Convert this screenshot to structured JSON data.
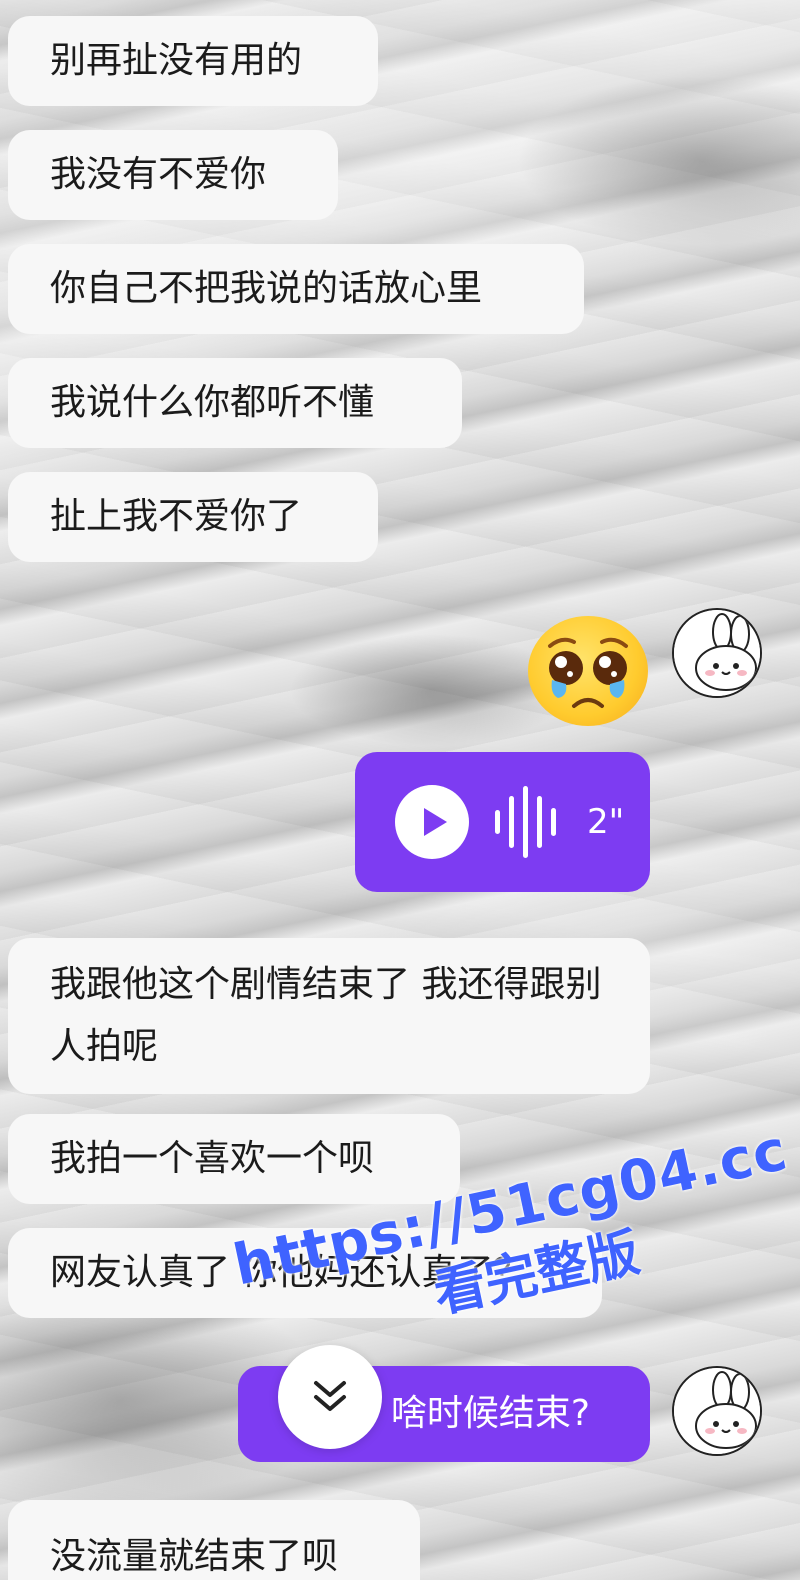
{
  "messages_received_top": [
    {
      "text": "别再扯没有用的"
    },
    {
      "text": "我没有不爱你"
    },
    {
      "text": "你自己不把我说的话放心里"
    },
    {
      "text": "我说什么你都听不懂"
    },
    {
      "text": "扯上我不爱你了"
    }
  ],
  "sent_emoji": {
    "icon": "pleading-crying-face-emoji"
  },
  "voice_message": {
    "duration": "2\"",
    "icon": "play-icon"
  },
  "messages_received_mid": [
    {
      "text": "我跟他这个剧情结束了 我还得跟别人拍呢"
    },
    {
      "text": "我拍一个喜欢一个呗"
    },
    {
      "text": "网友认真了 你他妈还认真了？"
    }
  ],
  "sent_text": {
    "visible_text": "啥时候结束?"
  },
  "partial_message": {
    "text": "没流量就结束了呗"
  },
  "scroll_button": {
    "icon": "double-chevron-down-icon"
  },
  "watermark": {
    "url": "https://51cg04.cc",
    "sub": "看完整版"
  },
  "colors": {
    "sent_bubble": "#7d3cf2",
    "received_bubble": "#f7f7f7",
    "watermark": "#3f63ff"
  }
}
